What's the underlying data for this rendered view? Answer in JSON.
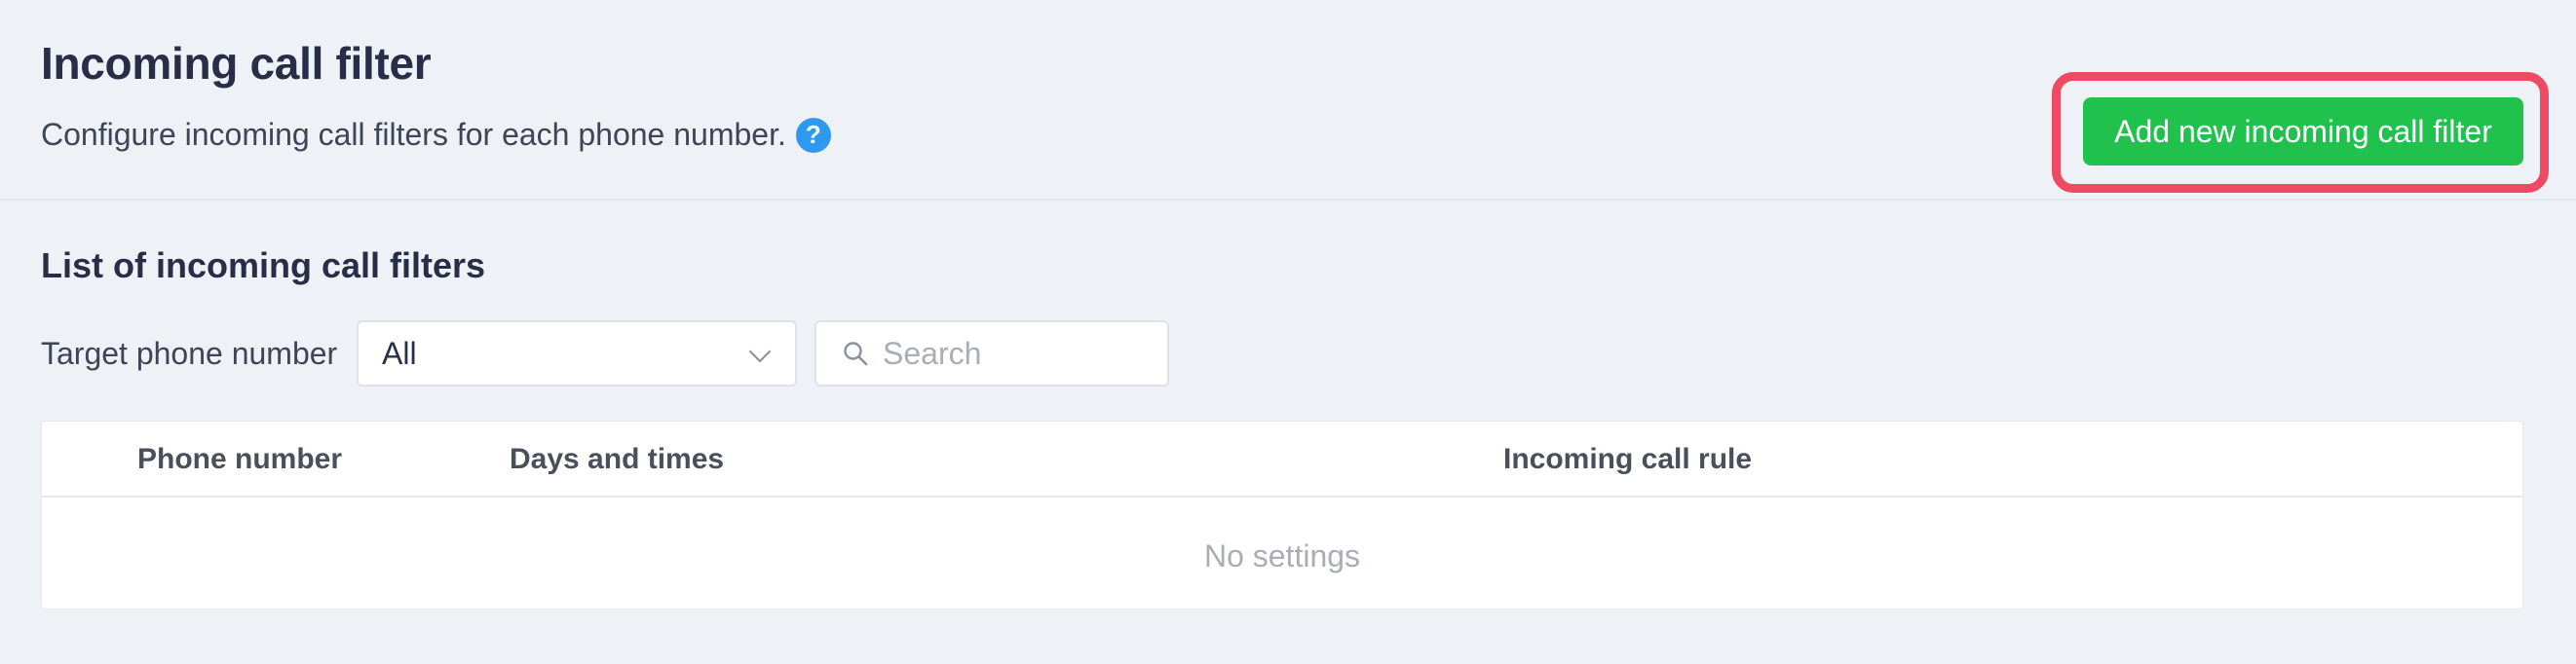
{
  "header": {
    "title": "Incoming call filter",
    "description": "Configure incoming call filters for each phone number.",
    "help_icon": "?",
    "add_button_label": "Add new incoming call filter"
  },
  "list": {
    "title": "List of incoming call filters",
    "filter_label": "Target phone number",
    "select_value": "All",
    "search_placeholder": "Search",
    "columns": [
      "Phone number",
      "Days and times",
      "Incoming call rule"
    ],
    "empty_text": "No settings"
  },
  "colors": {
    "accent_green": "#21c14d",
    "highlight_red": "#ef4a64",
    "help_blue": "#2d9af0"
  },
  "icons": {
    "help": "question-circle-icon",
    "search": "search-icon",
    "dropdown": "chevron-down-icon"
  }
}
